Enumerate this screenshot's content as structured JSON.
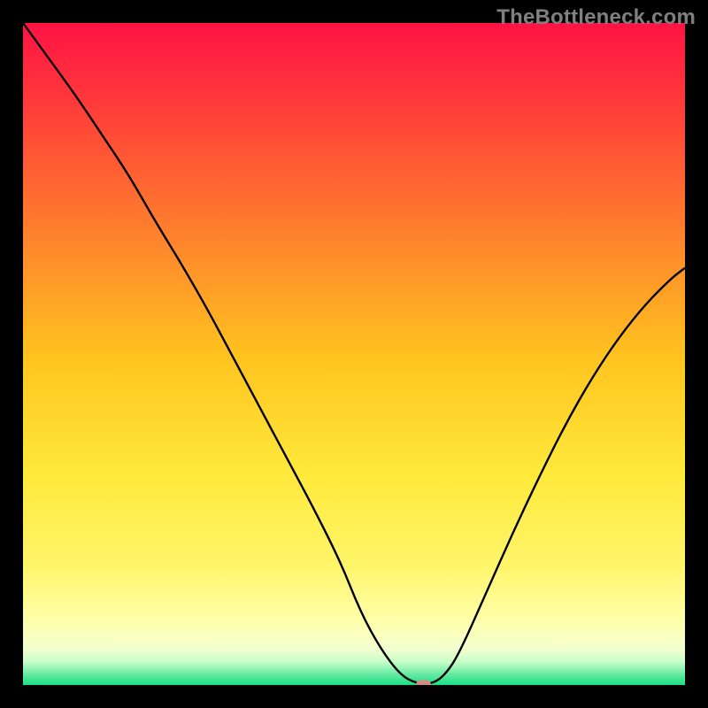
{
  "watermark": "TheBottleneck.com",
  "chart_data": {
    "type": "line",
    "title": "",
    "xlabel": "",
    "ylabel": "",
    "xlim": [
      0,
      100
    ],
    "ylim": [
      0,
      100
    ],
    "grid": false,
    "legend": false,
    "background": {
      "type": "vertical-gradient",
      "stops": [
        {
          "pos": 0.0,
          "color": "#ff1344"
        },
        {
          "pos": 0.12,
          "color": "#ff3a3a"
        },
        {
          "pos": 0.3,
          "color": "#ff7a2e"
        },
        {
          "pos": 0.5,
          "color": "#ffc21f"
        },
        {
          "pos": 0.68,
          "color": "#ffe93a"
        },
        {
          "pos": 0.82,
          "color": "#fff56a"
        },
        {
          "pos": 0.9,
          "color": "#ffffa8"
        },
        {
          "pos": 0.945,
          "color": "#f4ffd0"
        },
        {
          "pos": 0.965,
          "color": "#c8ffc8"
        },
        {
          "pos": 0.985,
          "color": "#60e8a0"
        },
        {
          "pos": 1.0,
          "color": "#18e184"
        }
      ]
    },
    "series": [
      {
        "name": "bottleneck-curve",
        "stroke": "#000000",
        "stroke_width": 2.4,
        "x": [
          0.0,
          4,
          8,
          12,
          16,
          20,
          24,
          28,
          32,
          36,
          40,
          44,
          48,
          51,
          54,
          57,
          59.5,
          62,
          64,
          66,
          70,
          74,
          78,
          82,
          86,
          90,
          94,
          98,
          100
        ],
        "y": [
          100,
          94.5,
          89,
          83,
          77,
          70,
          63.5,
          56.5,
          49,
          41.5,
          34,
          26.5,
          18.5,
          11,
          5.5,
          1.5,
          0.2,
          0.2,
          1.8,
          5,
          14,
          23,
          31.5,
          39.5,
          46.5,
          52.5,
          57.5,
          61.5,
          63
        ]
      }
    ],
    "marker": {
      "name": "optimal-point",
      "x": 60.5,
      "y": 0.2,
      "color": "#d38a82",
      "shape": "rounded-pill",
      "width_pct": 2.2,
      "height_pct": 1.1
    }
  }
}
